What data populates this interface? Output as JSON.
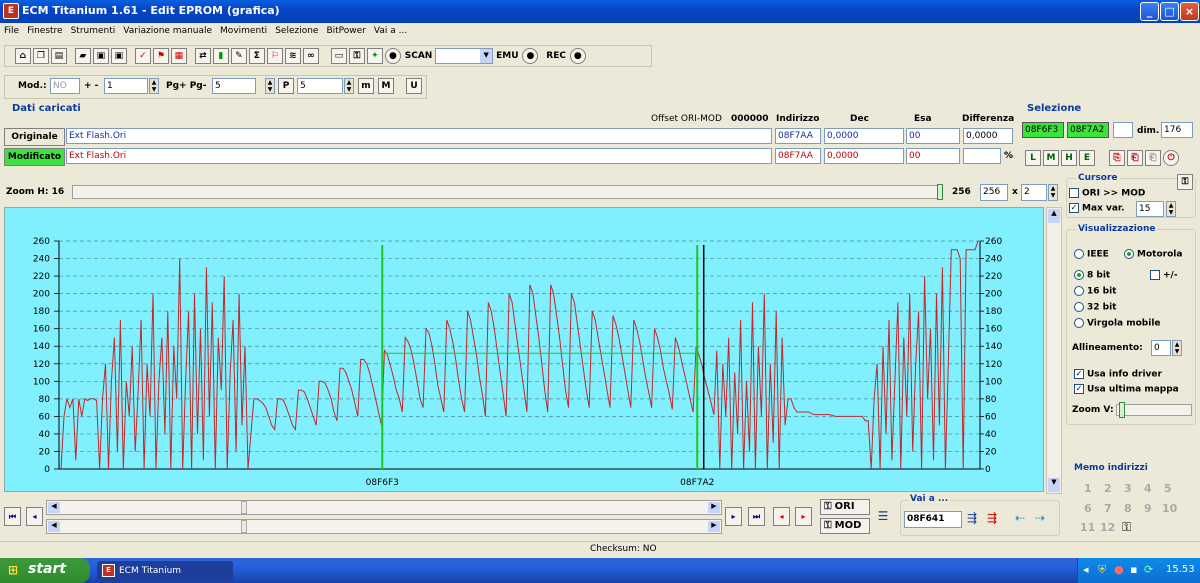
{
  "window": {
    "title": "ECM Titanium 1.61 - Edit EPROM (grafica)"
  },
  "menu": [
    "File",
    "Finestre",
    "Strumenti",
    "Variazione manuale",
    "Movimenti",
    "Selezione",
    "BitPower",
    "Vai a ..."
  ],
  "toolbar1": {
    "scan": "SCAN",
    "emu": "EMU",
    "rec": "REC"
  },
  "toolbar2": {
    "mod_label": "Mod.:",
    "mod_value": "NO",
    "plusminus": "+ -",
    "step_value": "1",
    "pgpg_label": "Pg+ Pg-",
    "pg_value": "5",
    "p_value": "5"
  },
  "dati": {
    "title": "Dati caricati",
    "offset_label": "Offset ORI-MOD",
    "offset_value": "000000",
    "col_indirizzo": "Indirizzo",
    "col_dec": "Dec",
    "col_esa": "Esa",
    "col_diff": "Differenza",
    "originale": {
      "label": "Originale",
      "file": "Ext Flash.Ori",
      "indirizzo": "08F7AA",
      "dec": "0,0000",
      "esa": "00",
      "diff": "0,0000"
    },
    "modificato": {
      "label": "Modificato",
      "file": "Ext Flash.Ori",
      "indirizzo": "08F7AA",
      "dec": "0,0000",
      "esa": "00",
      "diff": "",
      "pct": "%"
    }
  },
  "selezione": {
    "title": "Selezione",
    "from": "08F6F3",
    "to": "08F7A2",
    "dim_label": "dim.",
    "dim_value": "176"
  },
  "zoom": {
    "label": "Zoom H: 16",
    "value": "256",
    "field": "256",
    "times": "x",
    "mult": "2"
  },
  "cursore": {
    "title": "Cursore",
    "ori_mod": "ORI >> MOD",
    "max_var": "Max var.",
    "max_var_value": "15"
  },
  "visualizzazione": {
    "title": "Visualizzazione",
    "ieee": "IEEE",
    "motorola": "Motorola",
    "bit8": "8 bit",
    "plusminus": "+/-",
    "bit16": "16 bit",
    "bit32": "32 bit",
    "virgola": "Virgola mobile",
    "allineamento": "Allineamento:",
    "allineamento_value": "0",
    "info_driver": "Usa info driver",
    "ultima_mappa": "Usa ultima mappa",
    "zoom_v": "Zoom V:"
  },
  "memo": {
    "title": "Memo indirizzi",
    "numbers": [
      "1",
      "2",
      "3",
      "4",
      "5",
      "6",
      "7",
      "8",
      "9",
      "10",
      "11",
      "12"
    ]
  },
  "nav": {
    "ori": "ORI",
    "mod": "MOD",
    "vai_title": "Vai a ...",
    "vai_value": "08F641"
  },
  "status": {
    "checksum": "Checksum: NO"
  },
  "taskbar": {
    "start": "start",
    "app": "ECM Titanium",
    "clock": "15.53"
  },
  "colors": {
    "chart_bg": "#80f0ff",
    "series": "#c0282c",
    "marker": "#1ec81e",
    "cursor": "#000000"
  },
  "chart_data": {
    "type": "line",
    "ylim": [
      0,
      260
    ],
    "yticks": [
      0,
      20,
      40,
      60,
      80,
      100,
      120,
      140,
      160,
      180,
      200,
      220,
      240,
      260
    ],
    "markers": [
      "08F6F3",
      "08F7A2"
    ],
    "series": [
      {
        "values": [
          0,
          60,
          80,
          70,
          80,
          10,
          80,
          60,
          80,
          78,
          80,
          80,
          78,
          0,
          80,
          120,
          0,
          100,
          150,
          20,
          170,
          0,
          100,
          60,
          140,
          20,
          90,
          170,
          0,
          120,
          60,
          200,
          0,
          100,
          150,
          40,
          180,
          0,
          140,
          80,
          240,
          0,
          100,
          180,
          0,
          200,
          40,
          160,
          10,
          230,
          60,
          190,
          0,
          150,
          90,
          220,
          0,
          110,
          170,
          20,
          200,
          50,
          140,
          0,
          40,
          80,
          80,
          78,
          75,
          70,
          60,
          50,
          45,
          80,
          80,
          78,
          70,
          60,
          50,
          45,
          90,
          90,
          88,
          80,
          70,
          60,
          50,
          100,
          100,
          98,
          90,
          80,
          65,
          55,
          115,
          115,
          110,
          100,
          90,
          75,
          60,
          125,
          125,
          120,
          110,
          95,
          80,
          65,
          50,
          135,
          130,
          118,
          105,
          90,
          80,
          65,
          150,
          145,
          135,
          120,
          100,
          80,
          70,
          160,
          155,
          140,
          120,
          95,
          80,
          65,
          170,
          160,
          145,
          125,
          100,
          80,
          65,
          180,
          170,
          150,
          130,
          105,
          85,
          60,
          190,
          180,
          160,
          135,
          110,
          85,
          60,
          200,
          190,
          165,
          140,
          115,
          90,
          65,
          210,
          200,
          175,
          150,
          120,
          90,
          65,
          210,
          200,
          175,
          150,
          120,
          90,
          70,
          200,
          190,
          165,
          140,
          115,
          90,
          70,
          180,
          170,
          150,
          130,
          110,
          90,
          70,
          175,
          165,
          150,
          130,
          110,
          90,
          70,
          170,
          160,
          145,
          125,
          105,
          88,
          70,
          160,
          150,
          135,
          115,
          100,
          85,
          68,
          150,
          140,
          125,
          110,
          95,
          80,
          65,
          140,
          130,
          118,
          102,
          90,
          76,
          62,
          135,
          0,
          120,
          60,
          150,
          0,
          110,
          40,
          170,
          0,
          100,
          20,
          190,
          0,
          140,
          60,
          200,
          0,
          120,
          30,
          180,
          0,
          150,
          50,
          80,
          80,
          70,
          65,
          65,
          65,
          65,
          65,
          63,
          62,
          62,
          62,
          62,
          62,
          62,
          61,
          60,
          60,
          60,
          60,
          60,
          60,
          60,
          60,
          60,
          60,
          55,
          55,
          0,
          80,
          120,
          0,
          140,
          40,
          170,
          10,
          100,
          190,
          0,
          150,
          60,
          200,
          20,
          120,
          180,
          0,
          220,
          80,
          160,
          10,
          200,
          50,
          230,
          0,
          120,
          250,
          250,
          250,
          240,
          0,
          250,
          250,
          250,
          250,
          260
        ]
      }
    ]
  }
}
